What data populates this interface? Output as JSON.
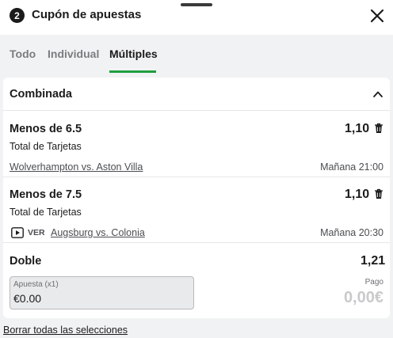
{
  "header": {
    "count": "2",
    "title": "Cupón de apuestas"
  },
  "tabs": [
    {
      "label": "Todo"
    },
    {
      "label": "Individual"
    },
    {
      "label": "Múltiples"
    }
  ],
  "section": {
    "title": "Combinada"
  },
  "selections": [
    {
      "market": "Menos de 6.5",
      "odds": "1,10",
      "type": "Total de Tarjetas",
      "match": "Wolverhampton vs. Aston Villa",
      "time": "Mañana 21:00"
    },
    {
      "market": "Menos de 7.5",
      "odds": "1,10",
      "type": "Total de Tarjetas",
      "watch_label": "VER",
      "match": "Augsburg vs. Colonia",
      "time": "Mañana 20:30"
    }
  ],
  "bet": {
    "label": "Doble",
    "odds": "1,21",
    "stake_label": "Apuesta (x1)",
    "stake_value": "€0.00",
    "payout_label": "Pago",
    "payout_value": "0,00€"
  },
  "footer": {
    "clear_label": "Borrar todas las selecciones"
  },
  "colors": {
    "accent": "#1e9e3e",
    "background": "#f1f2f3"
  }
}
